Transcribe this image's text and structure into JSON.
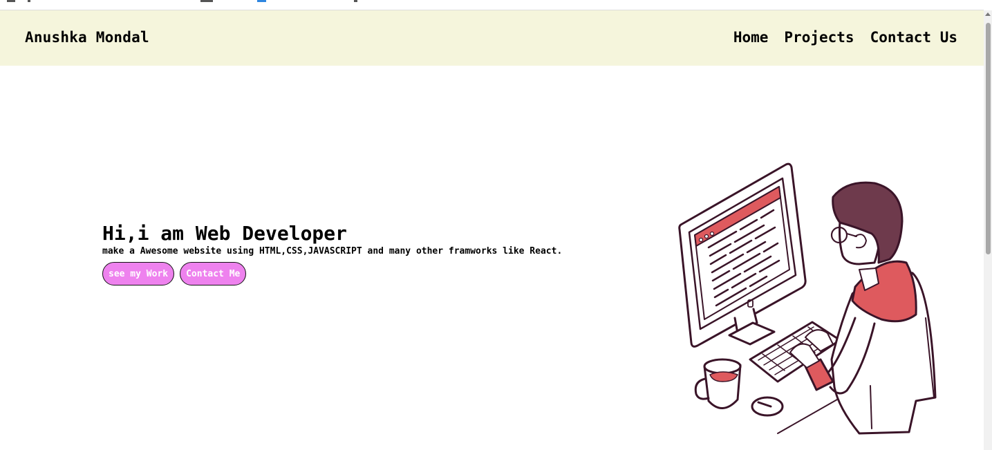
{
  "navbar": {
    "brand": "Anushka Mondal",
    "links": [
      "Home",
      "Projects",
      "Contact Us"
    ],
    "background": "#f5f5dc"
  },
  "hero": {
    "title": "Hi,i am Web Developer",
    "subtitle": "make a Awesome website using HTML,CSS,JAVASCRIPT and many other framworks like React.",
    "buttons": [
      "see my Work",
      "Contact Me"
    ],
    "button_color": "#ee82ee"
  },
  "illustration": {
    "icon": "developer-at-computer-illustration",
    "accent": "#de5a5e",
    "outline": "#3a1428"
  }
}
